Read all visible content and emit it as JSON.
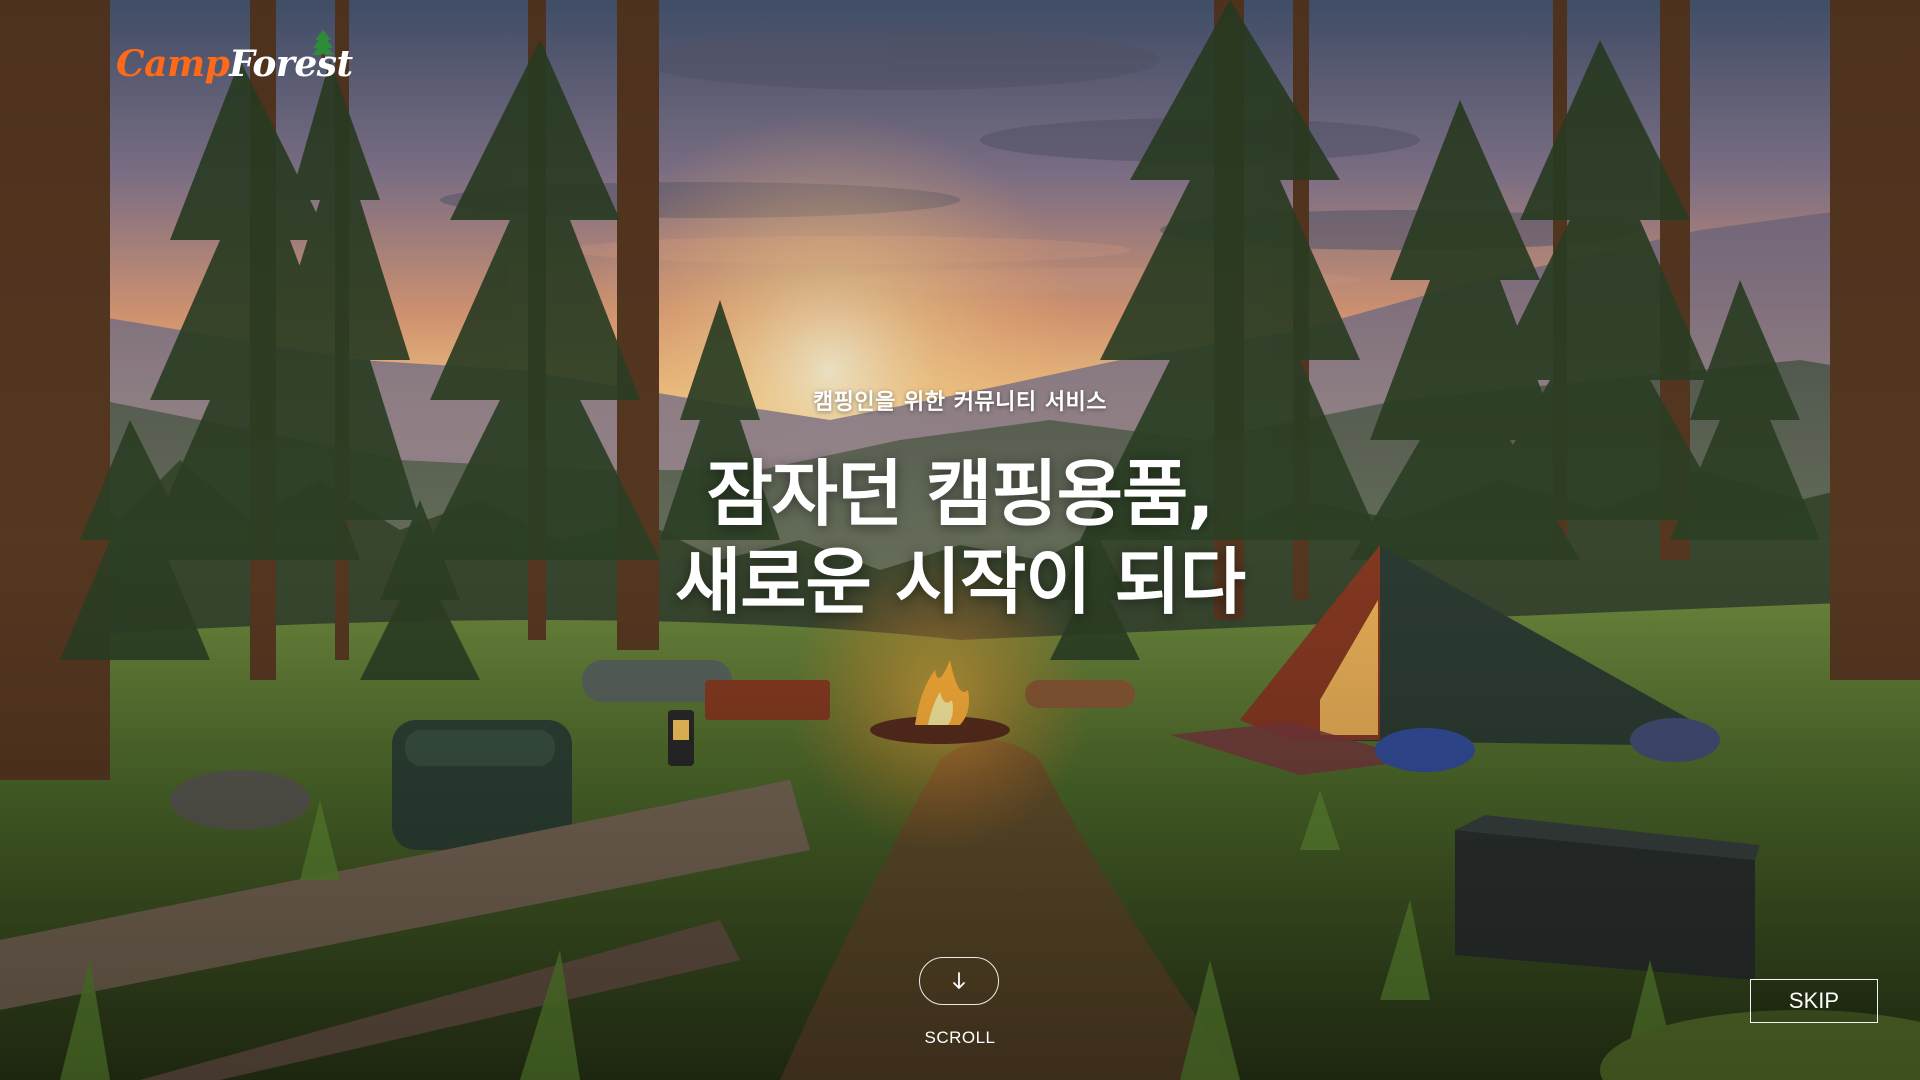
{
  "logo": {
    "part1": "Camp",
    "part2": "Forest"
  },
  "hero": {
    "subtitle": "캠핑인을 위한 커뮤니티 서비스",
    "title_line1": "잠자던 캠핑용품,",
    "title_line2": "새로운 시작이 되다"
  },
  "scroll": {
    "label": "SCROLL",
    "icon": "arrow-down-icon"
  },
  "skip": {
    "label": "SKIP"
  },
  "colors": {
    "brand_orange": "#ff6a1a",
    "text": "#ffffff"
  },
  "background": {
    "icon": "forest-campsite-sunset-image"
  }
}
